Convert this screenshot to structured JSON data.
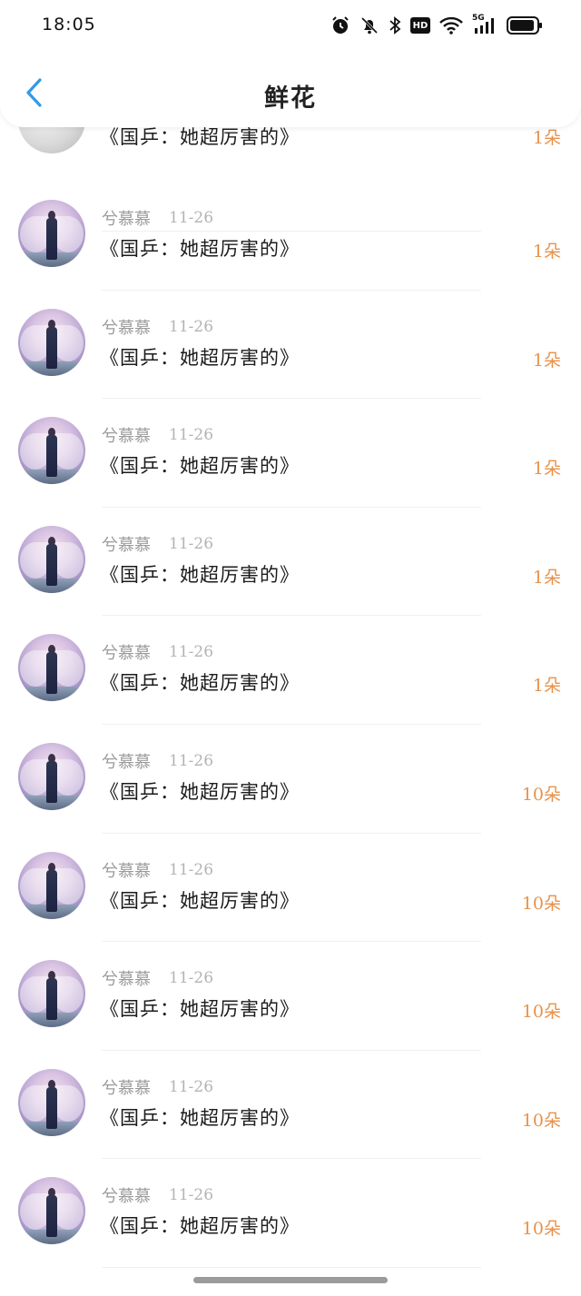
{
  "status_bar": {
    "time": "18:05",
    "icons": [
      "alarm-icon",
      "mute-icon",
      "bluetooth-icon",
      "hd-icon",
      "wifi-icon",
      "signal-5g-icon",
      "battery-icon"
    ],
    "hd_label": "HD",
    "network_label": "5G"
  },
  "nav": {
    "back_icon": "chevron-left-icon",
    "title": "鲜花"
  },
  "colors": {
    "accent": "#2f9ae6",
    "amount": "#e8924a",
    "name": "#9a9a9a",
    "date": "#b4b4b4"
  },
  "rows": [
    {
      "name": "",
      "date": "",
      "title": "《国乒：她超厉害的》",
      "amount": "1朵",
      "partial": true
    },
    {
      "name": "兮慕慕",
      "date": "11-26",
      "title": "《国乒：她超厉害的》",
      "amount": "1朵"
    },
    {
      "name": "兮慕慕",
      "date": "11-26",
      "title": "《国乒：她超厉害的》",
      "amount": "1朵"
    },
    {
      "name": "兮慕慕",
      "date": "11-26",
      "title": "《国乒：她超厉害的》",
      "amount": "1朵"
    },
    {
      "name": "兮慕慕",
      "date": "11-26",
      "title": "《国乒：她超厉害的》",
      "amount": "1朵"
    },
    {
      "name": "兮慕慕",
      "date": "11-26",
      "title": "《国乒：她超厉害的》",
      "amount": "1朵"
    },
    {
      "name": "兮慕慕",
      "date": "11-26",
      "title": "《国乒：她超厉害的》",
      "amount": "10朵"
    },
    {
      "name": "兮慕慕",
      "date": "11-26",
      "title": "《国乒：她超厉害的》",
      "amount": "10朵"
    },
    {
      "name": "兮慕慕",
      "date": "11-26",
      "title": "《国乒：她超厉害的》",
      "amount": "10朵"
    },
    {
      "name": "兮慕慕",
      "date": "11-26",
      "title": "《国乒：她超厉害的》",
      "amount": "10朵"
    },
    {
      "name": "兮慕慕",
      "date": "11-26",
      "title": "《国乒：她超厉害的》",
      "amount": "10朵"
    }
  ]
}
